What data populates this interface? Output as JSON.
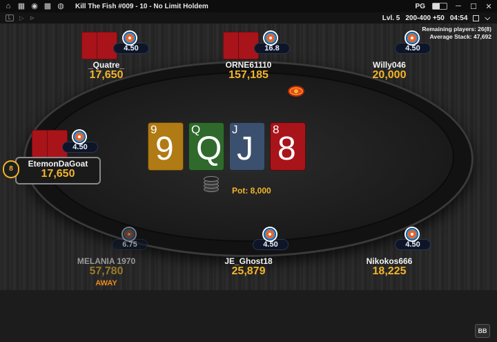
{
  "window": {
    "title": "Kill The Fish #009 - 10 - No Limit Holdem",
    "mode_label": "PG"
  },
  "toolbar": {
    "level": "Lvl. 5",
    "blinds": "200-400 +50",
    "timer": "04:54"
  },
  "tournament": {
    "remaining": "Remaining players: 26(8)",
    "average": "Average Stack: 47,692"
  },
  "players": [
    {
      "name": "_Quatre_",
      "stack": "17,650",
      "badge": "4.50"
    },
    {
      "name": "ORNE61110",
      "stack": "157,185",
      "badge": "16.8"
    },
    {
      "name": "Willy046",
      "stack": "20,000",
      "badge": "4.50"
    },
    {
      "name": "EtemonDaGoat",
      "stack": "17,650",
      "badge": "4.50",
      "seat_number": "8"
    },
    {
      "name": "MELANIA 1970",
      "stack": "57,780",
      "badge": "6.75",
      "status": "AWAY"
    },
    {
      "name": "JE_Ghost18",
      "stack": "25,879",
      "badge": "4.50"
    },
    {
      "name": "Nikokos666",
      "stack": "18,225",
      "badge": "4.50"
    }
  ],
  "board": [
    {
      "rank": "9",
      "color": "#b07a14"
    },
    {
      "rank": "Q",
      "color": "#2f6a2c"
    },
    {
      "rank": "J",
      "color": "#3b506e"
    },
    {
      "rank": "8",
      "color": "#a8141a"
    }
  ],
  "pot": "Pot: 8,000",
  "bb_button": "BB"
}
